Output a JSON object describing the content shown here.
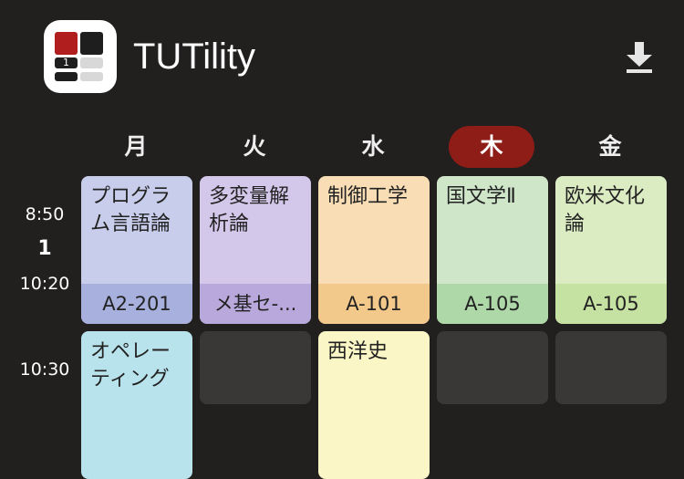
{
  "app": {
    "title": "TUTility",
    "icon_digit": "1",
    "icon": "timetable-logo-icon",
    "download_icon": "download-icon"
  },
  "days": [
    "月",
    "火",
    "水",
    "木",
    "金"
  ],
  "active_day": "木",
  "periods": [
    {
      "start": "8:50",
      "number": "1",
      "end": "10:20"
    },
    {
      "start": "10:30"
    }
  ],
  "period1": [
    {
      "name": "プログラム言語論",
      "room": "A2-201",
      "bg": "#c8cdeb",
      "room_bg": "#a8b0de"
    },
    {
      "name": "多変量解析論",
      "room": "メ基セ-...",
      "bg": "#d4c8ea",
      "room_bg": "#b8a8dc"
    },
    {
      "name": "制御工学",
      "room": "A-101",
      "bg": "#f8ddb5",
      "room_bg": "#f3c98b"
    },
    {
      "name": "国文学Ⅱ",
      "room": "A-105",
      "bg": "#cfe6c9",
      "room_bg": "#aed8a8"
    },
    {
      "name": "欧米文化論",
      "room": "A-105",
      "bg": "#dcecc2",
      "room_bg": "#c6e2a2"
    }
  ],
  "period2": [
    {
      "name": "オペレーティング",
      "bg": "#b9e3ec"
    },
    {
      "name": ""
    },
    {
      "name": "西洋史",
      "bg": "#fbf6c5"
    },
    {
      "name": ""
    },
    {
      "name": ""
    }
  ],
  "colors": {
    "background": "#221f1f",
    "accent": "#8e1d18",
    "empty_cell": "#3a3737"
  }
}
